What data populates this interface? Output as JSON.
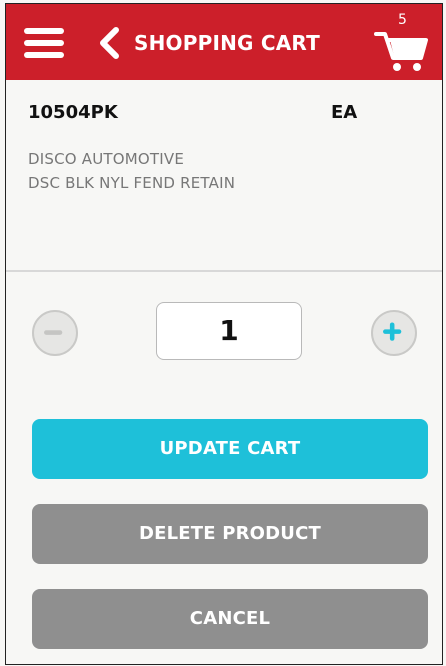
{
  "header": {
    "title": "SHOPPING CART",
    "cart_count": "5",
    "menu_icon": "hamburger-menu-icon",
    "back_icon": "chevron-left-icon",
    "cart_icon": "shopping-cart-icon"
  },
  "product": {
    "sku": "10504PK",
    "uom": "EA",
    "brand": "DISCO AUTOMOTIVE",
    "description": "DSC BLK NYL FEND RETAIN"
  },
  "quantity": {
    "value": "1",
    "decrement_icon": "minus-icon",
    "increment_icon": "plus-icon"
  },
  "actions": {
    "update_label": "UPDATE CART",
    "delete_label": "DELETE PRODUCT",
    "cancel_label": "CANCEL"
  },
  "colors": {
    "header": "#cc1f2a",
    "primary": "#1ec0d9",
    "secondary": "#8f8f8f",
    "background": "#f7f7f5"
  }
}
